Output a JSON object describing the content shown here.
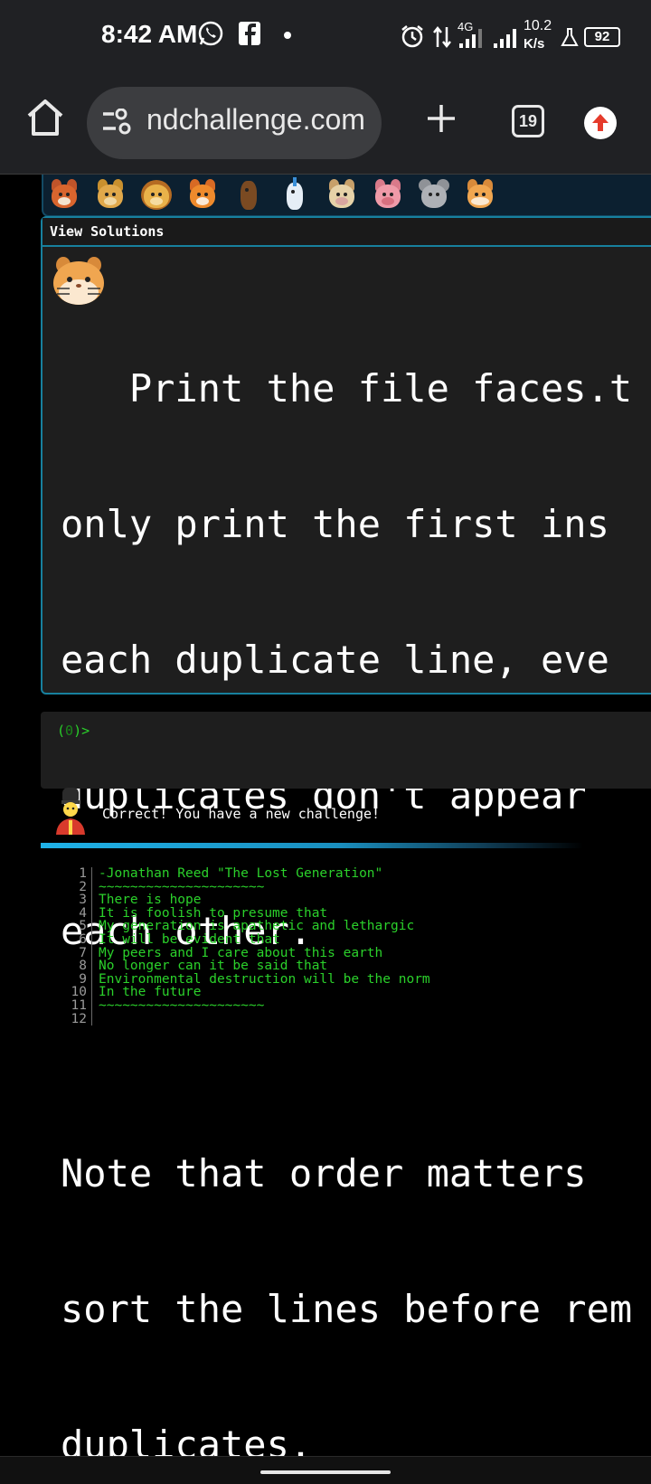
{
  "status_bar": {
    "time": "8:42 AM",
    "network_type": "4G",
    "speed_value": "10.2",
    "speed_unit": "K/s",
    "battery": "92"
  },
  "browser": {
    "url": "ndchallenge.com",
    "tab_count": "19"
  },
  "emoji_strip": {
    "items": [
      "fox-icon",
      "cat-icon",
      "lion-icon",
      "tiger-icon",
      "horse-icon",
      "unicorn-icon",
      "cow-icon",
      "pig-icon",
      "mouse-icon",
      "hamster-icon"
    ]
  },
  "challenge": {
    "view_solutions_label": "View Solutions",
    "text_lines": [
      "   Print the file faces.t",
      "only print the first ins",
      "each duplicate line, eve",
      "duplicates don't appear ",
      "each other."
    ],
    "note_lines": [
      "Note that order matters ",
      "sort the lines before rem",
      "duplicates."
    ]
  },
  "terminal": {
    "prompt_open": "(",
    "prompt_num": "0",
    "prompt_close": ")>"
  },
  "feedback": {
    "message": "Correct! You have a new challenge!"
  },
  "file_view": {
    "lines": [
      {
        "n": "1",
        "t": "-Jonathan Reed \"The Lost Generation\""
      },
      {
        "n": "2",
        "t": "~~~~~~~~~~~~~~~~~~~~~"
      },
      {
        "n": "3",
        "t": "There is hope"
      },
      {
        "n": "4",
        "t": "It is foolish to presume that"
      },
      {
        "n": "5",
        "t": "My generation is apathetic and lethargic"
      },
      {
        "n": "6",
        "t": "It will be evident that"
      },
      {
        "n": "7",
        "t": "My peers and I care about this earth"
      },
      {
        "n": "8",
        "t": "No longer can it be said that"
      },
      {
        "n": "9",
        "t": "Environmental destruction will be the norm"
      },
      {
        "n": "10",
        "t": "In the future"
      },
      {
        "n": "11",
        "t": "~~~~~~~~~~~~~~~~~~~~~"
      },
      {
        "n": "12",
        "t": ""
      }
    ]
  },
  "colors": {
    "accent": "#17809e",
    "terminal_green": "#2bd12b",
    "progress_blue": "#1fb2e8"
  }
}
